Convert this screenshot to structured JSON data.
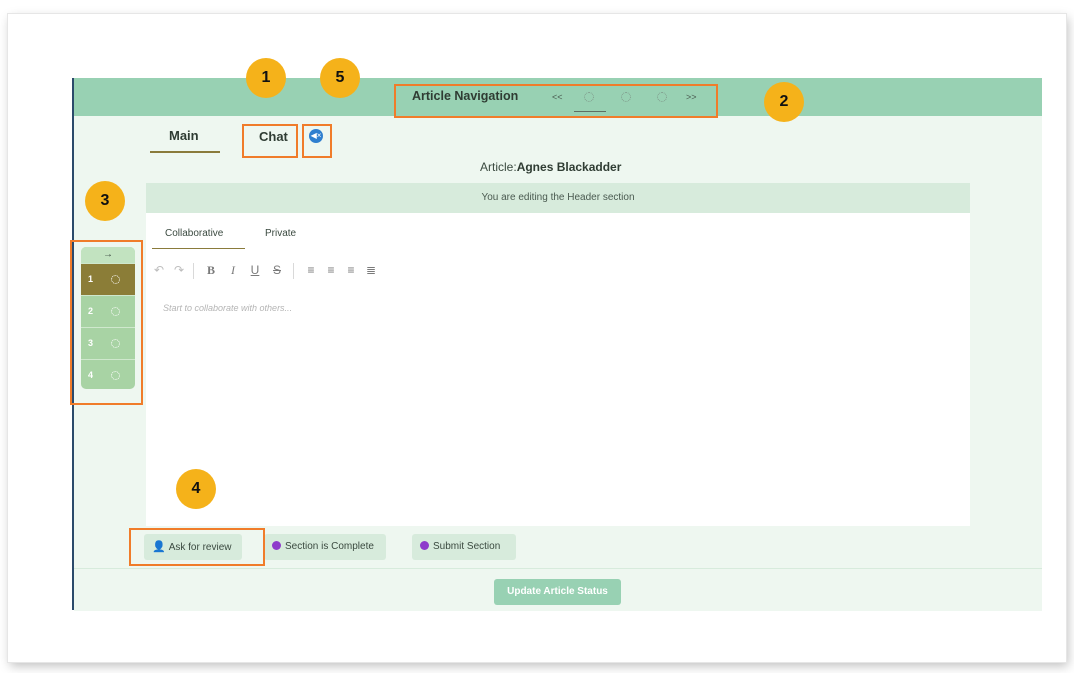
{
  "top_nav": {
    "title": "Article Navigation",
    "prev": "<<",
    "next": ">>"
  },
  "tabs": {
    "main": "Main",
    "chat": "Chat"
  },
  "article": {
    "prefix": "Article:",
    "name": "Agnes Blackadder"
  },
  "editor": {
    "banner": "You are editing the Header section",
    "subtabs": [
      "Collaborative",
      "Private"
    ],
    "placeholder": "Start to collaborate with others..."
  },
  "section_nav": {
    "arrow": "→",
    "items": [
      "1",
      "2",
      "3",
      "4"
    ],
    "active": "1"
  },
  "actions": {
    "ask_review": "Ask for review",
    "section_complete": "Section is Complete",
    "submit_section": "Submit Section"
  },
  "footer": {
    "update_label": "Update Article Status"
  },
  "annotations": {
    "badges": [
      "1",
      "5",
      "2",
      "3",
      "4"
    ]
  },
  "colors": {
    "topbar": "#98d1b3",
    "active_section": "#8b7d37",
    "highlight": "#f07c2a",
    "badge": "#f5b21a",
    "icon_purple": "#8e3ccb"
  }
}
